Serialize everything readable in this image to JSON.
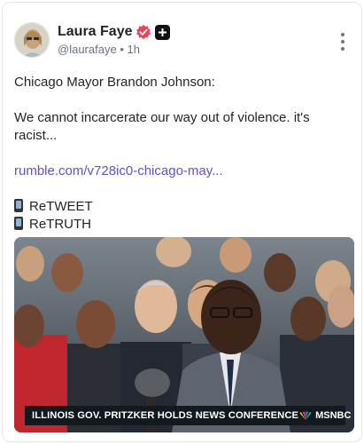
{
  "author": {
    "name": "Laura Faye",
    "handle": "@laurafaye",
    "separator": "•",
    "time": "1h"
  },
  "post": {
    "line1": "Chicago Mayor Brandon Johnson:",
    "line2": "We cannot incarcerate our way out of violence. it's racist...",
    "link": "rumble.com/v728ic0-chicago-may...",
    "retweet": "ReTWEET",
    "retruth": "ReTRUTH"
  },
  "media": {
    "chyron": "ILLINOIS GOV. PRITZKER HOLDS NEWS CONFERENCE",
    "network": "MSNBC"
  },
  "colors": {
    "link": "#6450c8",
    "verified": "#e8455a",
    "chyron_bg": "#14181f"
  }
}
